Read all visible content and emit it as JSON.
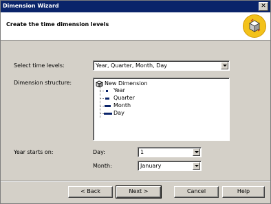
{
  "window": {
    "title": "Dimension Wizard",
    "close_glyph": "✕"
  },
  "header": {
    "heading": "Create the time dimension levels",
    "logo_icon": "dimension-wizard-icon"
  },
  "form": {
    "time_levels_label": "Select time levels:",
    "time_levels_value": "Year, Quarter, Month, Day",
    "structure_label": "Dimension structure:",
    "year_starts_label": "Year starts on:",
    "day_label": "Day:",
    "day_value": "1",
    "month_label": "Month:",
    "month_value": "January"
  },
  "tree": {
    "root": "New Dimension",
    "levels": [
      "Year",
      "Quarter",
      "Month",
      "Day"
    ]
  },
  "buttons": {
    "back": "< Back",
    "next": "Next >",
    "cancel": "Cancel",
    "help": "Help"
  },
  "colors": {
    "titlebar": "#0a246a",
    "face": "#d4d0c8",
    "logo": "#f3c21a"
  }
}
